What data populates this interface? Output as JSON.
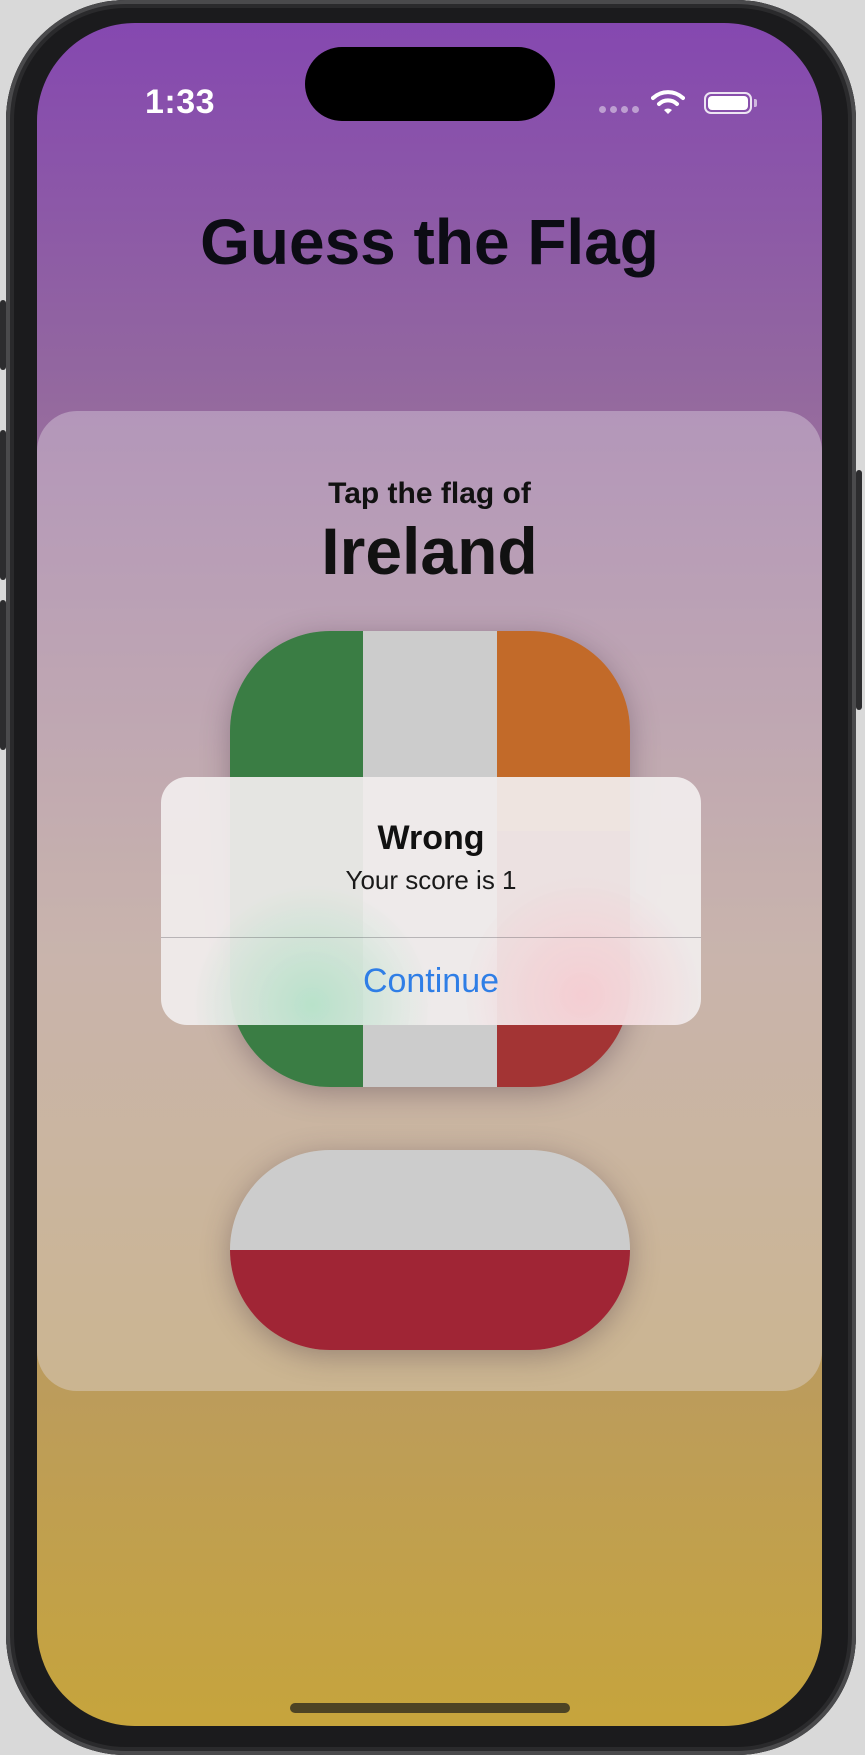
{
  "status_bar": {
    "time": "1:33",
    "icons": [
      "cellular-signal-icon",
      "wifi-icon",
      "battery-icon"
    ]
  },
  "app": {
    "title": "Guess the Flag",
    "prompt": "Tap the flag of",
    "country": "Ireland"
  },
  "flags": [
    {
      "name": "Ireland",
      "stripe_direction": "vertical",
      "colors": [
        "#3a7d44",
        "#cccccc",
        "#c26a29"
      ]
    },
    {
      "name": "Italy",
      "stripe_direction": "vertical",
      "colors": [
        "#3a7d44",
        "#cccccc",
        "#a33434"
      ]
    },
    {
      "name": "Poland",
      "stripe_direction": "horizontal",
      "colors": [
        "#cccccc",
        "#a02535"
      ]
    }
  ],
  "alert": {
    "title": "Wrong",
    "message": "Your score is 1",
    "button_label": "Continue"
  },
  "colors": {
    "gradient_top": "#8548b0",
    "gradient_bottom": "#c6a43c",
    "accent_blue": "#2f7ee6"
  }
}
